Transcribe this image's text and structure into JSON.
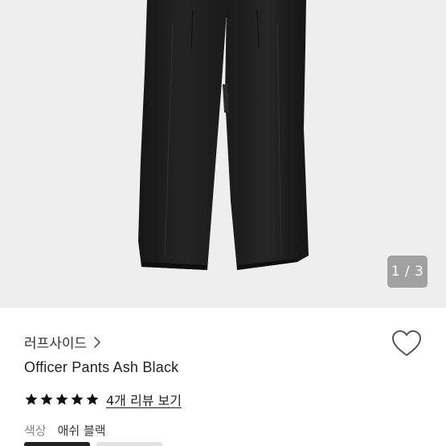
{
  "gallery": {
    "counter": "1 / 3",
    "background": "#eeeeee",
    "product_color": "#1f1f1f"
  },
  "product": {
    "brand": "러프사이드",
    "brand_chevron_icon": "chevron-right-icon",
    "wishlist_icon": "heart-outline-icon",
    "title": "Officer Pants Ash Black",
    "rating_stars": 5,
    "star_icon": "filled-star-icon",
    "review_link": "4개 리뷰 보기",
    "option_label": "색상",
    "option_value": "애쉬 블랙"
  }
}
